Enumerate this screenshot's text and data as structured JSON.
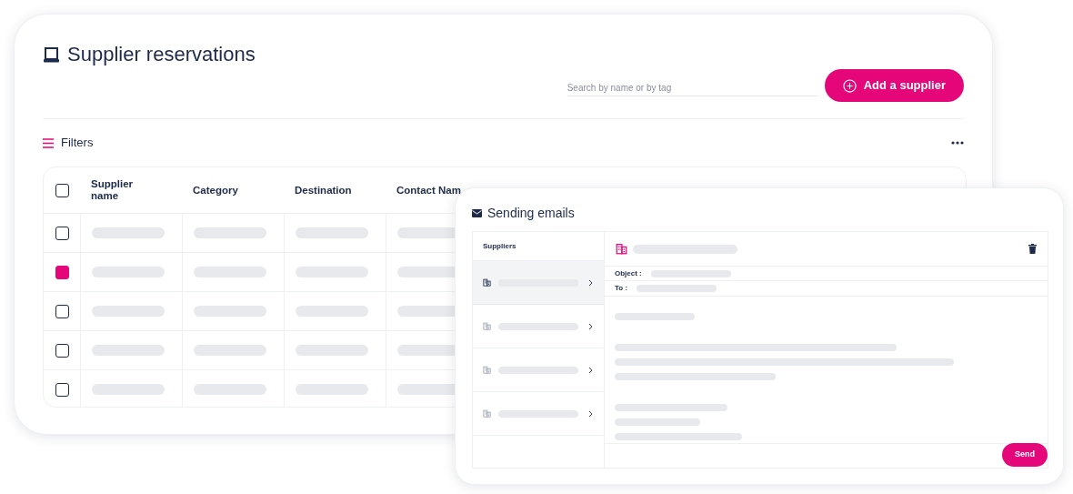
{
  "page": {
    "title": "Supplier reservations"
  },
  "search": {
    "placeholder": "Search by name or by tag"
  },
  "add_button": {
    "label": "Add a supplier"
  },
  "filters": {
    "label": "Filters"
  },
  "table": {
    "select_all_checked": false,
    "columns": [
      "Supplier name",
      "Category",
      "Destination",
      "Contact Nam"
    ],
    "rows": [
      {
        "checked": false
      },
      {
        "checked": true
      },
      {
        "checked": false
      },
      {
        "checked": false
      },
      {
        "checked": false
      }
    ]
  },
  "email_panel": {
    "title": "Sending emails",
    "suppliers_heading": "Suppliers",
    "suppliers": [
      {
        "selected": true
      },
      {
        "selected": false
      },
      {
        "selected": false
      },
      {
        "selected": false
      }
    ],
    "object_label": "Object :",
    "to_label": "To :",
    "send_button": "Send"
  }
}
